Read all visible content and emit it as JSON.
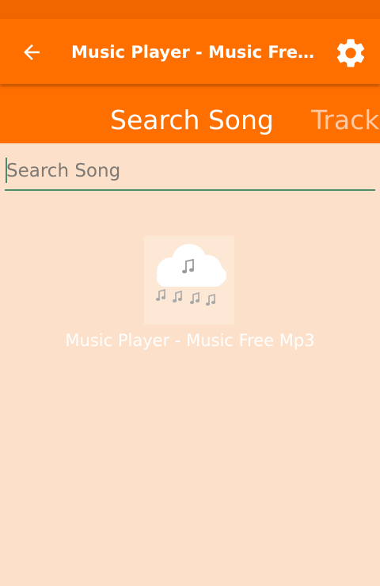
{
  "app_bar": {
    "title": "Music Player - Music Free Mp3",
    "back_icon": "arrow-left-icon",
    "settings_icon": "gear-icon"
  },
  "tabs": [
    {
      "label": "Search Song",
      "selected": true
    },
    {
      "label": "Track",
      "selected": false
    }
  ],
  "search": {
    "value": "",
    "placeholder": "Search Song"
  },
  "album": {
    "title": "Music Player - Music Free Mp3",
    "art_icon": "cloud-music-icon"
  },
  "colors": {
    "primary": "#ff6f00",
    "status_bar": "#f06700",
    "background": "#fde0c9",
    "accent": "#4e8b6a"
  }
}
